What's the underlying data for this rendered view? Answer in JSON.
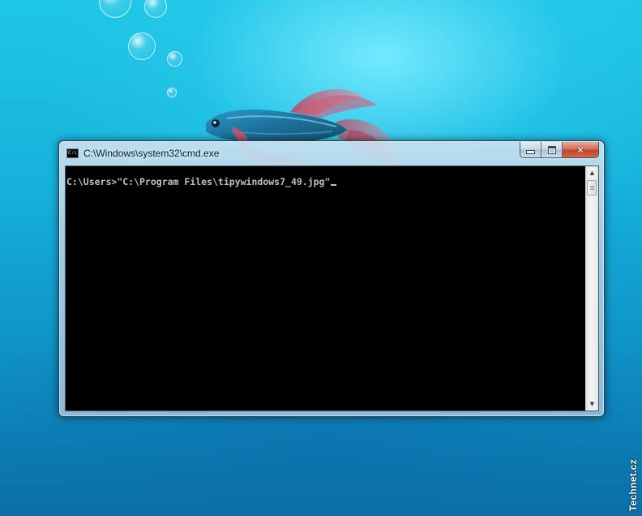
{
  "window": {
    "title": "C:\\Windows\\system32\\cmd.exe",
    "icon_name": "cmd-app-icon",
    "icon_text": "C:\\",
    "buttons": {
      "minimize": "minimize-icon",
      "maximize": "maximize-icon",
      "close_label": "✕"
    }
  },
  "console": {
    "prompt": "C:\\Users>",
    "command": "\"C:\\Program Files\\tipywindows7_49.jpg\""
  },
  "scrollbar": {
    "up_arrow": "▲",
    "down_arrow": "▼"
  },
  "watermark": {
    "text": "Technet.cz"
  },
  "colors": {
    "console_background": "#000000",
    "console_text": "#c0c0c0",
    "desktop_accent": "#1fc7e6",
    "close_button": "#c2442a"
  }
}
